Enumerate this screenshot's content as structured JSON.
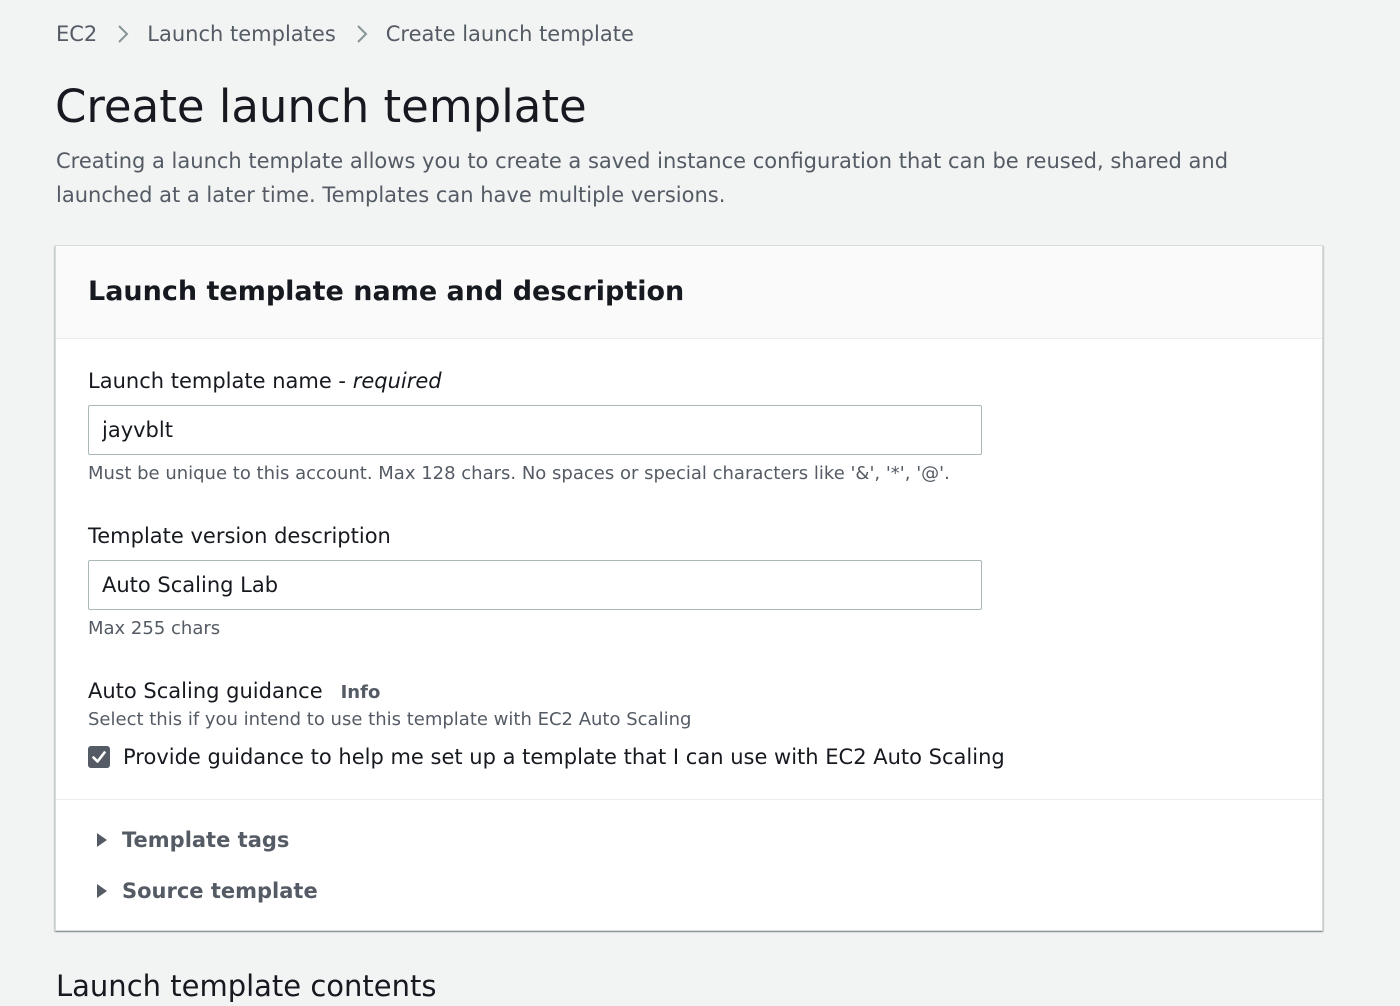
{
  "breadcrumb": {
    "items": [
      "EC2",
      "Launch templates",
      "Create launch template"
    ]
  },
  "page": {
    "title": "Create launch template",
    "description": "Creating a launch template allows you to create a saved instance configuration that can be reused, shared and launched at a later time. Templates can have multiple versions."
  },
  "panel": {
    "title": "Launch template name and description",
    "name_field": {
      "label": "Launch template name - ",
      "required_label": "required",
      "value": "jayvblt",
      "hint": "Must be unique to this account. Max 128 chars. No spaces or special characters like '&', '*', '@'."
    },
    "description_field": {
      "label": "Template version description",
      "value": "Auto Scaling Lab",
      "hint": "Max 255 chars"
    },
    "guidance": {
      "label": "Auto Scaling guidance",
      "info_label": "Info",
      "hint": "Select this if you intend to use this template with EC2 Auto Scaling",
      "checkbox_label": "Provide guidance to help me set up a template that I can use with EC2 Auto Scaling",
      "checked": true
    },
    "expanders": {
      "template_tags": "Template tags",
      "source_template": "Source template"
    }
  },
  "next_section": {
    "title": "Launch template contents"
  },
  "icons": {
    "breadcrumb_separator": "chevron-right-icon",
    "checkbox": "checkmark-icon",
    "expander": "caret-right-icon"
  },
  "colors": {
    "background": "#f2f3f3",
    "panel": "#ffffff",
    "text": "#16191f",
    "secondary_text": "#545b64",
    "input_border": "#aab7b8"
  }
}
